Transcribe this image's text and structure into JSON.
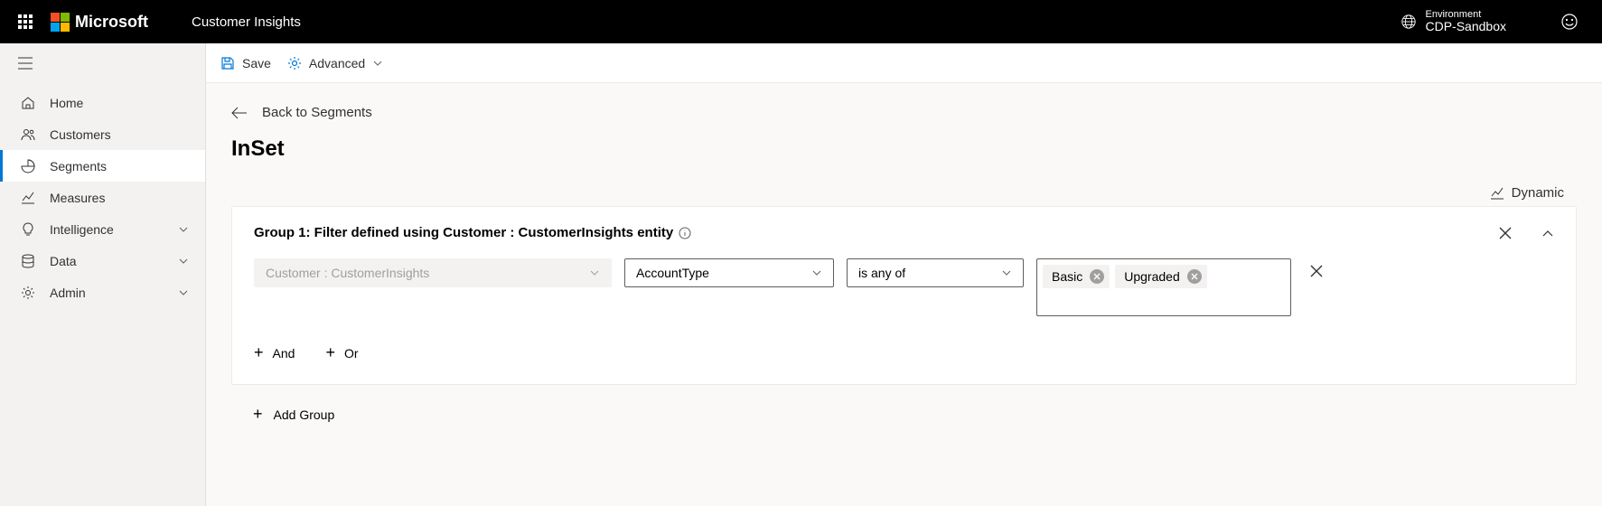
{
  "header": {
    "brand": "Microsoft",
    "app": "Customer Insights",
    "env_label": "Environment",
    "env_name": "CDP-Sandbox"
  },
  "sidebar": {
    "items": [
      {
        "label": "Home",
        "expandable": false,
        "active": false
      },
      {
        "label": "Customers",
        "expandable": false,
        "active": false
      },
      {
        "label": "Segments",
        "expandable": false,
        "active": true
      },
      {
        "label": "Measures",
        "expandable": false,
        "active": false
      },
      {
        "label": "Intelligence",
        "expandable": true,
        "active": false
      },
      {
        "label": "Data",
        "expandable": true,
        "active": false
      },
      {
        "label": "Admin",
        "expandable": true,
        "active": false
      }
    ]
  },
  "commandbar": {
    "save": "Save",
    "advanced": "Advanced"
  },
  "back_label": "Back to Segments",
  "page_title": "InSet",
  "mode_label": "Dynamic",
  "group": {
    "title": "Group 1: Filter defined using Customer : CustomerInsights entity",
    "entity_value": "Customer : CustomerInsights",
    "field_value": "AccountType",
    "operator_value": "is any of",
    "tags": [
      "Basic",
      "Upgraded"
    ],
    "and_label": "And",
    "or_label": "Or"
  },
  "add_group_label": "Add Group"
}
